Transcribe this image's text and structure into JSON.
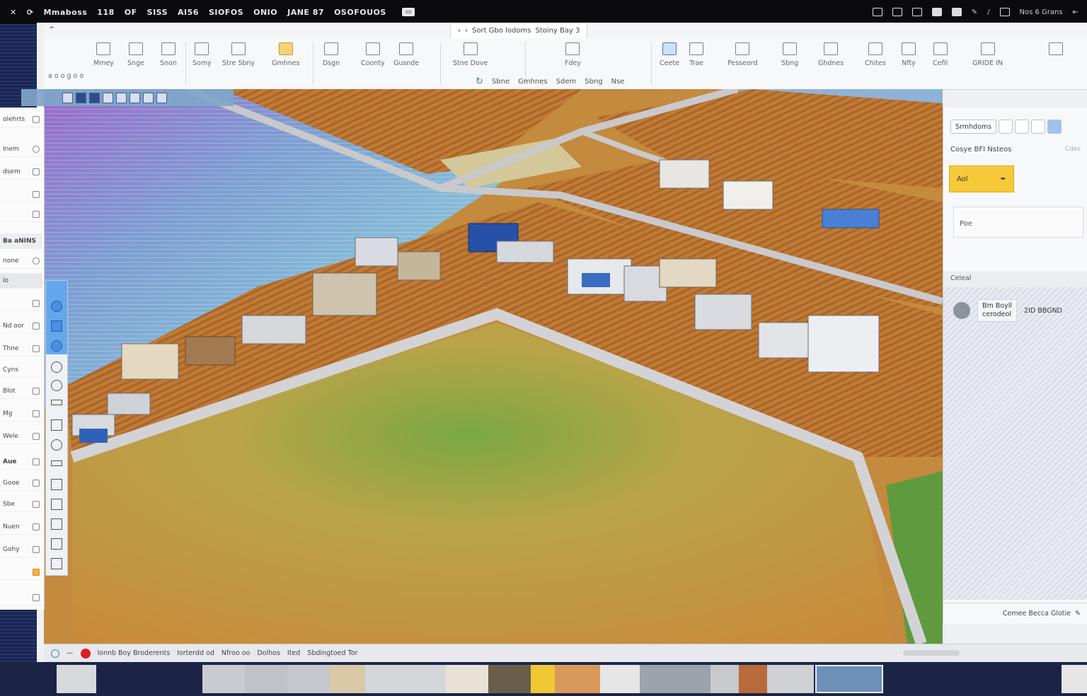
{
  "menubar": {
    "items": [
      "Mmaboss",
      "118",
      "OF",
      "SISS",
      "AI56",
      "SIOFOS",
      "ONIO",
      "JANE 87",
      "OSOFOUOS"
    ],
    "badge": "",
    "right_text": "Nos 6 Grans",
    "right_number": "6"
  },
  "tabstrip": {
    "doc_title": "Sort Gbo lodoms",
    "doc_meta": "Stoiny Bay 3"
  },
  "ribbon": {
    "groups": [
      {
        "label": "Mmey"
      },
      {
        "label": "Snge"
      },
      {
        "label": "Snon"
      },
      {
        "label": "Somy"
      },
      {
        "label": "Stre Sbny"
      },
      {
        "label": "Gmhnes"
      },
      {
        "label": "Dsgn"
      },
      {
        "label": "Coonty"
      },
      {
        "label": "Gusnde"
      },
      {
        "label": "Stne Dove"
      },
      {
        "label": "Fdey"
      },
      {
        "label": "Ceete"
      },
      {
        "label": "Trae"
      },
      {
        "label": "Pesseord"
      },
      {
        "label": "Sbng"
      },
      {
        "label": "Ghdnes"
      },
      {
        "label": "Chites"
      },
      {
        "label": "Nfty"
      },
      {
        "label": "Cefil"
      },
      {
        "label": "GRIDE IN"
      }
    ],
    "row_label": "a o o g  o o",
    "subbar": [
      "Sbne",
      "Gmhnes",
      "Sdem",
      "Sbng",
      "Nse"
    ]
  },
  "left_panel": {
    "rows": [
      "olehrts",
      "Inem",
      "dsem",
      "",
      "",
      "Ba aNINS",
      "none",
      "lo",
      "",
      "Nd oor",
      "Thne",
      "Cyns",
      "Blot",
      "Mg",
      "Wele",
      "Aue",
      "Gooe",
      "Sbe",
      "Nuen",
      "Gohy",
      "",
      ""
    ]
  },
  "right_panel": {
    "tab_label": "Srmhdoms",
    "section_title": "Cosye BFI Nsteos",
    "section_title_right": "Cdes",
    "yellow_button": "Aol",
    "input_text": "Poe",
    "list_header": "Celeal",
    "list_item": {
      "line1": "Bm Boyll",
      "line2": "cerodeol",
      "meta": "2ID BBGND"
    },
    "footer": "Cemee Becca Glotie"
  },
  "statusbar": {
    "items": [
      "lonnb Boy Broderents",
      "Iorterdd od",
      "Nfroo oo",
      "Dolhos",
      "Ited",
      "Sbdingtoed Tor"
    ]
  },
  "colors": {
    "accent_yellow": "#f6c93a",
    "record_red": "#d9201e",
    "highlight_blue": "#4a9be8"
  }
}
